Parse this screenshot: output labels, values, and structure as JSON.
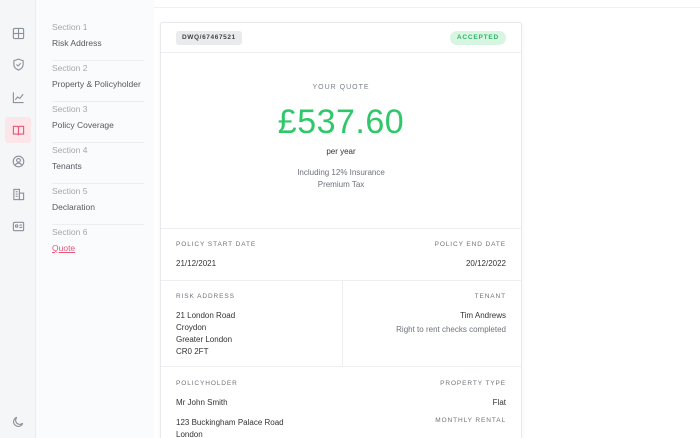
{
  "nav_rail": {
    "icons": [
      "grid-icon",
      "shield-icon",
      "chart-icon",
      "book-icon",
      "user-icon",
      "building-icon",
      "id-card-icon",
      "moon-icon"
    ],
    "active_icon": "book-icon",
    "active_color": "#e5587a"
  },
  "steps": [
    {
      "number": "Section 1",
      "name": "Risk Address"
    },
    {
      "number": "Section 2",
      "name": "Property & Policyholder"
    },
    {
      "number": "Section 3",
      "name": "Policy Coverage"
    },
    {
      "number": "Section 4",
      "name": "Tenants"
    },
    {
      "number": "Section 5",
      "name": "Declaration"
    },
    {
      "number": "Section 6",
      "name": "Quote"
    }
  ],
  "card": {
    "reference": "DWQ/67467521",
    "status": "ACCEPTED",
    "quote_label": "YOUR QUOTE",
    "price": "£537.60",
    "period": "per year",
    "tax_line1": "Including 12% Insurance",
    "tax_line2": "Premium Tax",
    "policy_start_label": "POLICY START DATE",
    "policy_start": "21/12/2021",
    "policy_end_label": "POLICY END DATE",
    "policy_end": "20/12/2022",
    "risk_address_label": "RISK ADDRESS",
    "risk_address": [
      "21 London Road",
      "Croydon",
      "Greater London",
      "CR0 2FT"
    ],
    "tenant_label": "TENANT",
    "tenant_name": "Tim Andrews",
    "tenant_note": "Right to rent checks completed",
    "policyholder_label": "POLICYHOLDER",
    "policyholder_name": "Mr John Smith",
    "policyholder_address": [
      "123 Buckingham Palace Road",
      "London"
    ],
    "property_type_label": "PROPERTY TYPE",
    "property_type": "Flat",
    "monthly_rental_label": "MONTHLY RENTAL"
  },
  "colors": {
    "price_green": "#2ec86b",
    "status_green": "#2ab567",
    "accent_pink": "#e5587a"
  }
}
